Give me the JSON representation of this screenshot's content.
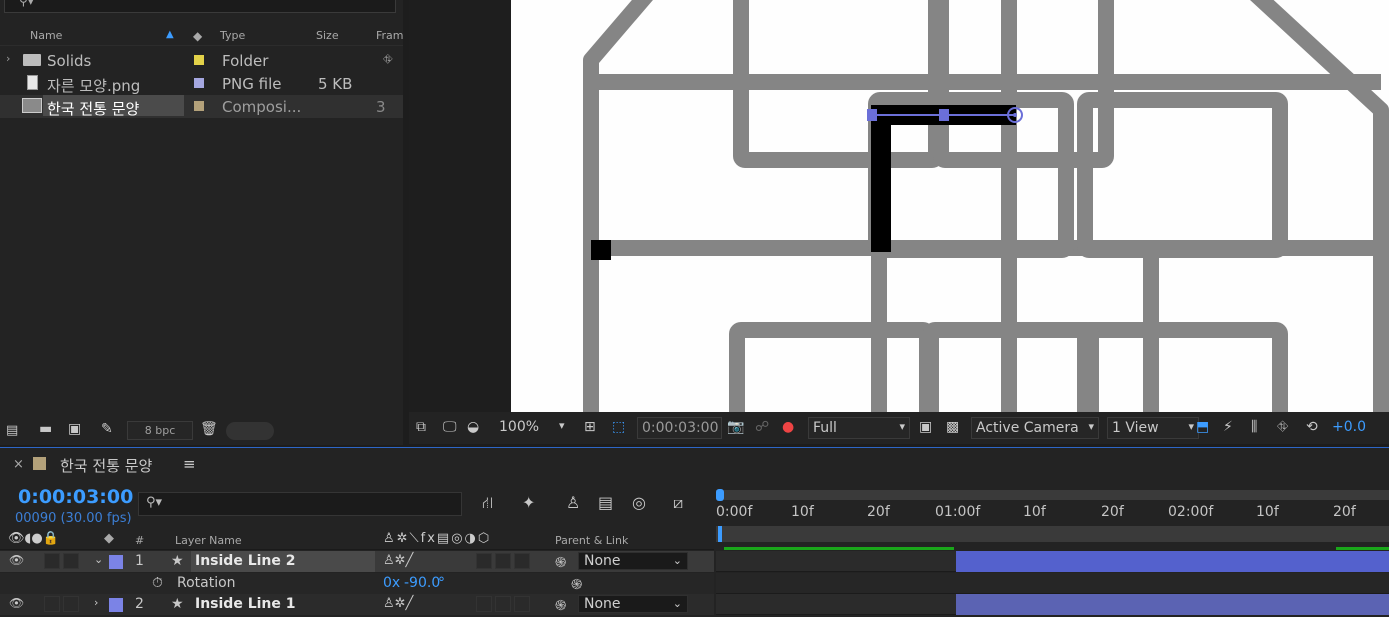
{
  "project": {
    "columns": {
      "name": "Name",
      "type": "Type",
      "size": "Size",
      "frame": "Fram"
    },
    "items": [
      {
        "name": "Solids",
        "type": "Folder",
        "size": "",
        "swatch": "#e3d249"
      },
      {
        "name": "자른 모양.png",
        "type": "PNG file",
        "size": "5 KB",
        "swatch": "#a5a7e0"
      },
      {
        "name": "한국 전통 문양",
        "type": "Composi...",
        "size": "3",
        "swatch": "#b3a17a"
      }
    ],
    "bpc": "8 bpc"
  },
  "viewer": {
    "zoom": "100%",
    "time": "0:00:03:00",
    "resolution": "Full",
    "camera": "Active Camera",
    "views": "1 View",
    "exposure": "+0.0"
  },
  "timeline": {
    "comp_name": "한국 전통 문양",
    "timecode": "0:00:03:00",
    "frame_info": "00090 (30.00 fps)",
    "header": {
      "num": "#",
      "layer_name": "Layer Name",
      "parent": "Parent & Link"
    },
    "layers": [
      {
        "num": "1",
        "name": "Inside Line 2",
        "parent": "None"
      },
      {
        "num": "2",
        "name": "Inside Line 1",
        "parent": "None"
      }
    ],
    "property": {
      "name": "Rotation",
      "value_prefix": "0x",
      "value": "-90.0",
      "unit": "°"
    },
    "ruler_labels": [
      "0:00f",
      "10f",
      "20f",
      "01:00f",
      "10f",
      "20f",
      "02:00f",
      "10f",
      "20f"
    ]
  },
  "colors": {
    "accent": "#3c9cff",
    "layer_label": "#7b83e6",
    "bar": "#5b67c9"
  }
}
